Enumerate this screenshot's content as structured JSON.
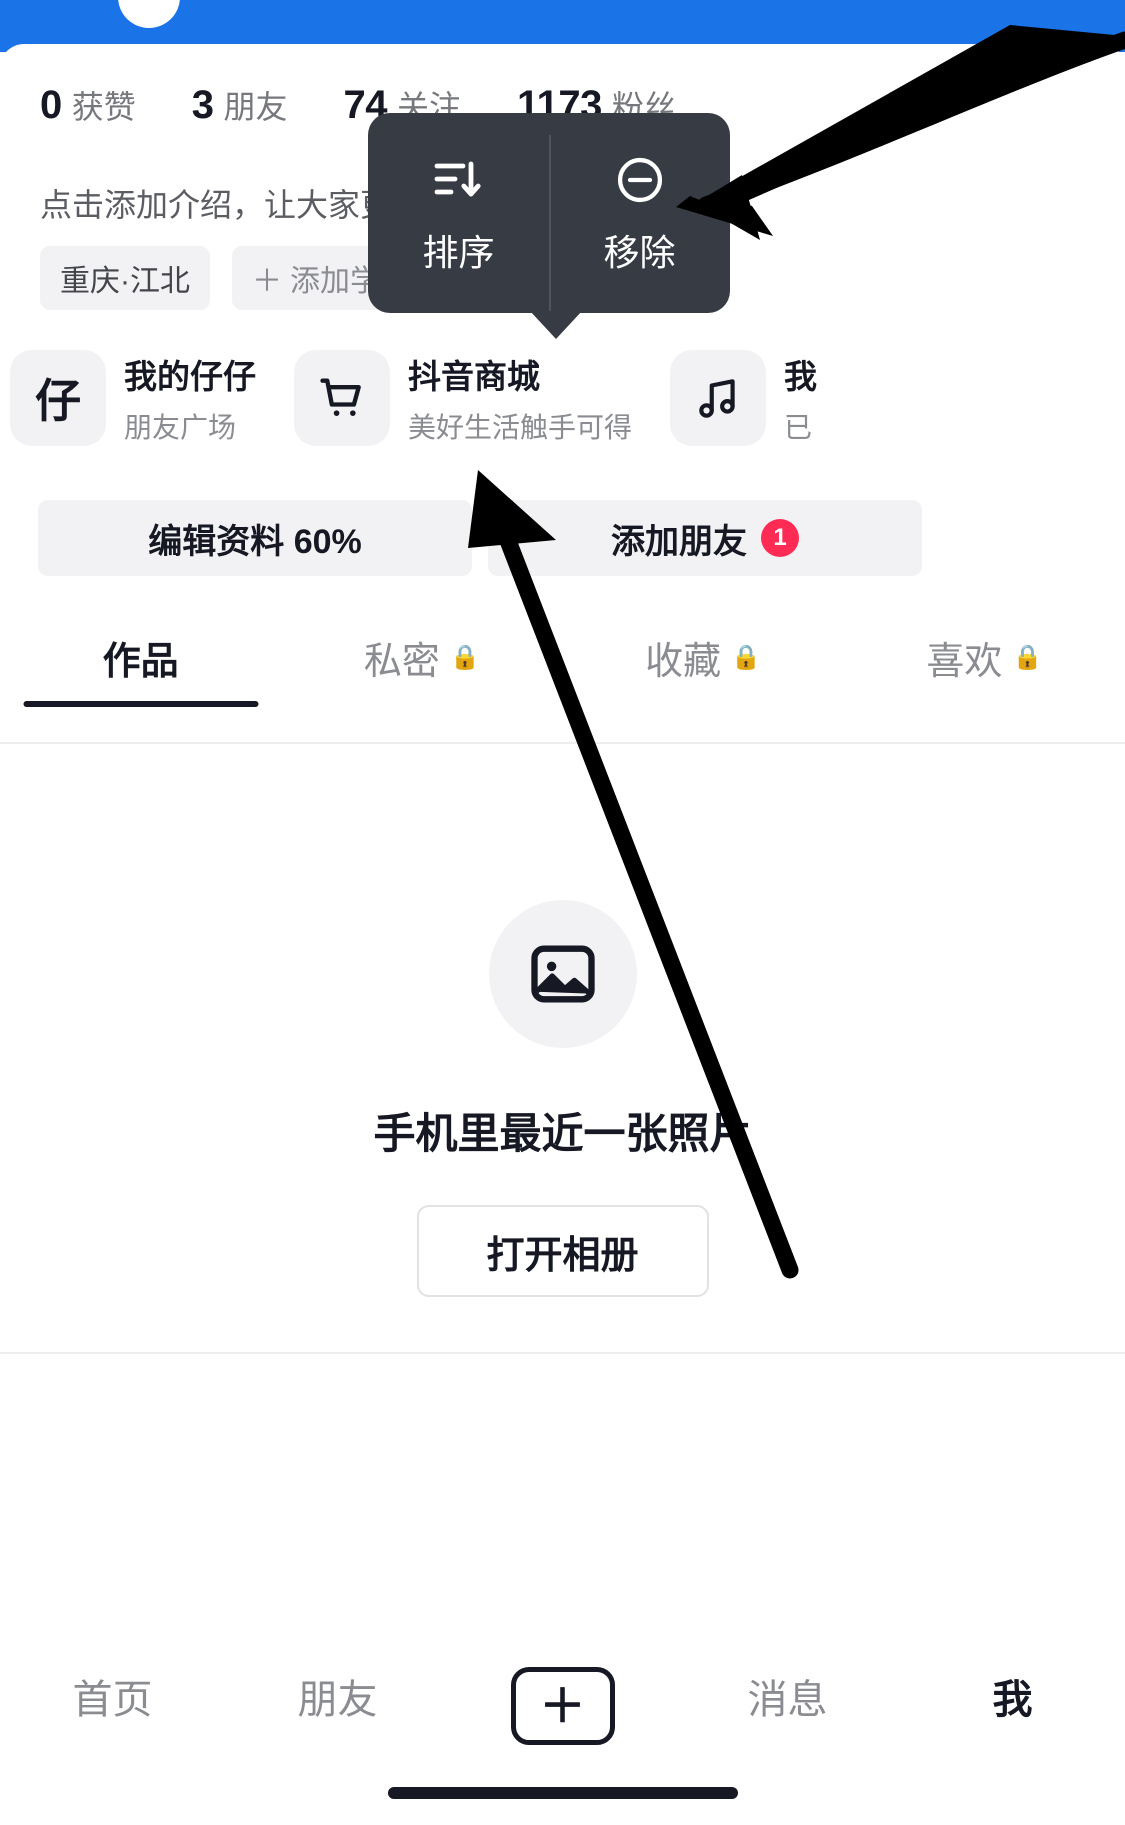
{
  "app": {
    "name": "douyin-profile",
    "accent_blue": "#1a74e8",
    "badge_red": "#fe2c55",
    "tooltip_bg": "#373c44"
  },
  "stats": [
    {
      "num": "0",
      "label": "获赞"
    },
    {
      "num": "3",
      "label": "朋友"
    },
    {
      "num": "74",
      "label": "关注"
    },
    {
      "num": "1173",
      "label": "粉丝"
    }
  ],
  "bio": {
    "text": "点击添加介绍，让大家更了解你"
  },
  "tags": [
    {
      "label": "重庆·江北",
      "plus": ""
    },
    {
      "label": "添加学校",
      "plus": "＋"
    }
  ],
  "shortcuts": [
    {
      "icon_glyph": "仔",
      "icon_name": "zaizai-icon",
      "title": "我的仔仔",
      "subtitle": "朋友广场"
    },
    {
      "icon_glyph": "cart",
      "icon_name": "shopping-cart-icon",
      "title": "抖音商城",
      "subtitle": "美好生活触手可得"
    },
    {
      "icon_glyph": "music",
      "icon_name": "music-note-icon",
      "title": "我",
      "subtitle": "已"
    }
  ],
  "actions": {
    "edit_profile": "编辑资料 60%",
    "add_friend": "添加朋友",
    "add_friend_badge": "1"
  },
  "tabs": [
    {
      "label": "作品",
      "locked": false,
      "active": true
    },
    {
      "label": "私密",
      "locked": true,
      "active": false
    },
    {
      "label": "收藏",
      "locked": true,
      "active": false
    },
    {
      "label": "喜欢",
      "locked": true,
      "active": false
    }
  ],
  "lock_glyph": "🔒",
  "empty_state": {
    "icon_name": "photo-icon",
    "caption": "手机里最近一张照片",
    "button": "打开相册"
  },
  "bottom_nav": [
    {
      "label": "首页",
      "active": false
    },
    {
      "label": "朋友",
      "active": false
    },
    {
      "label": "＋",
      "active": false,
      "is_plus": true
    },
    {
      "label": "消息",
      "active": false
    },
    {
      "label": "我",
      "active": true
    }
  ],
  "tooltip": {
    "items": [
      {
        "icon_name": "sort-icon",
        "label": "排序"
      },
      {
        "icon_name": "minus-circle-icon",
        "label": "移除"
      }
    ]
  }
}
